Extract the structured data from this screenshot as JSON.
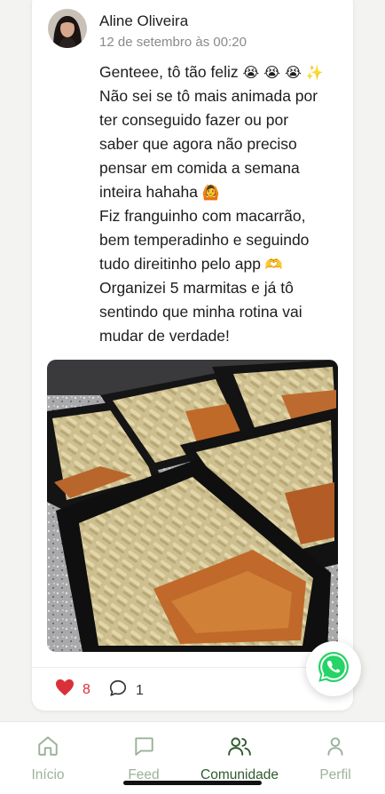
{
  "post": {
    "author_name": "Aline Oliveira",
    "timestamp": "12 de setembro às 00:20",
    "text_lines": [
      "Genteee, tô tão feliz",
      "Não sei se tô mais animada por",
      "ter conseguido fazer ou por",
      "saber que agora não preciso",
      "pensar em comida a semana",
      "inteira hahaha",
      "Fiz franguinho com macarrão,",
      "bem temperadinho e seguindo",
      "tudo direitinho pelo app",
      "Organizei 5 marmitas e já tô",
      "sentindo que minha rotina vai",
      "mudar de verdade!"
    ],
    "emojis": {
      "line1": "😭 😭 😭 ✨",
      "line6": "🙆",
      "line9": "🫶"
    },
    "likes": "8",
    "comments": "1"
  },
  "colors": {
    "like_red": "#d9303a",
    "nav_active": "#2f5a2e",
    "nav_inactive": "#9bb29a",
    "whatsapp_green": "#25d366"
  },
  "bottom_nav": {
    "items": [
      {
        "label": "Início",
        "icon": "home-icon"
      },
      {
        "label": "Feed",
        "icon": "chat-icon"
      },
      {
        "label": "Comunidade",
        "icon": "users-icon"
      },
      {
        "label": "Perfil",
        "icon": "user-icon"
      }
    ],
    "active": "Comunidade"
  }
}
